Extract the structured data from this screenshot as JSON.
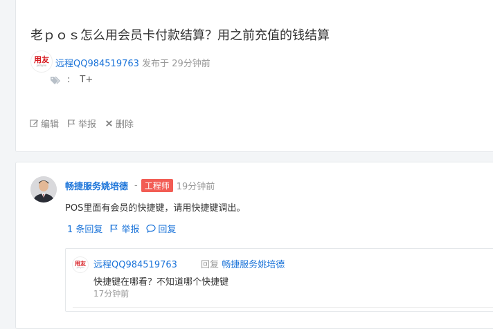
{
  "question": {
    "title": "老ｐｏｓ怎么用会员卡付款结算？用之前充值的钱结算",
    "author": "远程QQ984519763",
    "posted_label": "发布于",
    "posted_time": "29分钟前",
    "tag_separator": ":",
    "tag": "T+",
    "actions": {
      "edit": "编辑",
      "report": "举报",
      "delete": "删除"
    },
    "logo": {
      "main": "用友",
      "sub": "yonyou"
    }
  },
  "answer": {
    "author": "畅捷服务姚培德",
    "dash": "-",
    "badge": "工程师",
    "time": "19分钟前",
    "text": "POS里面有会员的快捷键，请用快捷键调出。",
    "actions": {
      "replies": "1 条回复",
      "report": "举报",
      "reply": "回复"
    }
  },
  "reply": {
    "author": "远程QQ984519763",
    "reply_label": "回复",
    "reply_to": "畅捷服务姚培德",
    "text": "快捷键在哪看？不知道哪个快捷键",
    "time": "17分钟前",
    "logo": {
      "main": "用友",
      "sub": "yonyou"
    }
  },
  "colors": {
    "link": "#1a73d9",
    "badge": "#f25c54",
    "brand_red": "#d6171c"
  }
}
